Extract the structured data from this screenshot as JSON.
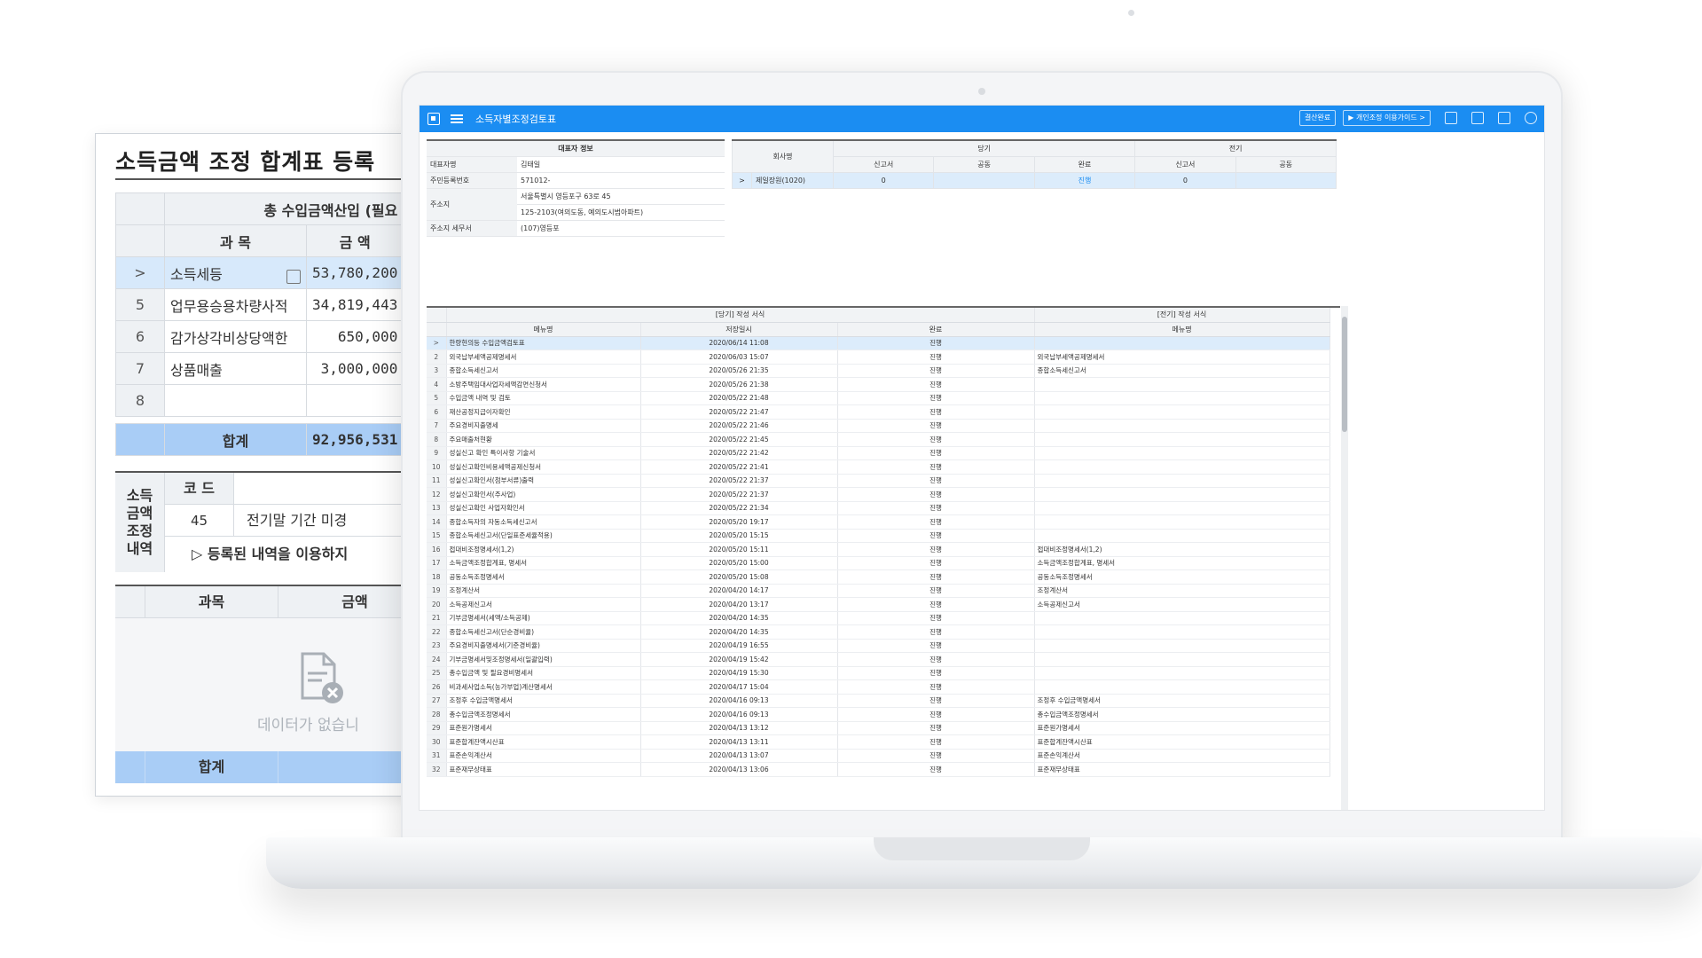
{
  "side_panel": {
    "title": "소득금액 조정 합계표 등록",
    "top_header": "총 수입금액산입 (필요",
    "col_item": "과 목",
    "col_amount": "금 액",
    "rows": [
      {
        "num": ">",
        "item": "소득세등",
        "amount": "53,780,200",
        "selected": true
      },
      {
        "num": "5",
        "item": "업무용승용차량사적",
        "amount": "34,819,443"
      },
      {
        "num": "6",
        "item": "감가상각비상당액한",
        "amount": "650,000"
      },
      {
        "num": "7",
        "item": "상품매출",
        "amount": "3,000,000"
      },
      {
        "num": "8",
        "item": "",
        "amount": ""
      }
    ],
    "total_label": "합계",
    "total_amount": "92,956,531",
    "adjust": {
      "label": "소득 금액 조정 내역",
      "code_header": "코 드",
      "code": "45",
      "desc": "전기말 기간 미경",
      "hint": "▷ 등록된 내역을 이용하지"
    },
    "grid2": {
      "col_item": "과목",
      "col_amount": "금액",
      "empty_text": "데이터가 없습니",
      "total_label": "합계"
    }
  },
  "app": {
    "title": "소득자별조정검토표",
    "btn1": "결산완료",
    "btn2": "개인조정 이용가이드 >"
  },
  "info": {
    "header": "대표자 정보",
    "rows": [
      {
        "k": "대표자명",
        "v": "김태일"
      },
      {
        "k": "주민등록번호",
        "v": "                     571012-"
      },
      {
        "k": "주소지",
        "v": "서울특별시 영등포구 63로 45"
      },
      {
        "k": "",
        "v": "125-2103(여의도동, 예의도시범아파트)"
      },
      {
        "k": "주소지 세무서",
        "v": "(107)영등포"
      }
    ]
  },
  "period": {
    "h_company": "회사명",
    "h_current": "당기",
    "h_prior": "전기",
    "sub": [
      "신고서",
      "공동",
      "완료",
      "신고서",
      "공동"
    ],
    "row": {
      "marker": ">",
      "company": "제일장원(1020)",
      "c1": "0",
      "c2": "",
      "c3": "진행",
      "c4": "0",
      "c5": ""
    }
  },
  "grid": {
    "h_current": "[당기] 작성 서식",
    "h_prior": "[전기] 작성 서식",
    "col_menu": "메뉴명",
    "col_saved": "저장일시",
    "col_done": "완료",
    "col_prior_menu": "메뉴명",
    "rows": [
      {
        "n": ">",
        "menu": "한량현의등 수입금액검토표",
        "date": "2020/06/14 11:08",
        "done": "진행",
        "prior": ""
      },
      {
        "n": "2",
        "menu": "외국납부세액공제명세서",
        "date": "2020/06/03 15:07",
        "done": "진행",
        "prior": "외국납부세액공제명세서"
      },
      {
        "n": "3",
        "menu": "종합소득세신고서",
        "date": "2020/05/26 21:35",
        "done": "진행",
        "prior": "종합소득세신고서"
      },
      {
        "n": "4",
        "menu": "소방주택임대사업자세액감면신청서",
        "date": "2020/05/26 21:38",
        "done": "진행",
        "prior": ""
      },
      {
        "n": "5",
        "menu": "수입금액 내역 및 검토",
        "date": "2020/05/22 21:48",
        "done": "진행",
        "prior": ""
      },
      {
        "n": "6",
        "menu": "재산공정지급이자확인",
        "date": "2020/05/22 21:47",
        "done": "진행",
        "prior": ""
      },
      {
        "n": "7",
        "menu": "주요경비지출명세",
        "date": "2020/05/22 21:46",
        "done": "진행",
        "prior": ""
      },
      {
        "n": "8",
        "menu": "주요매출처현황",
        "date": "2020/05/22 21:45",
        "done": "진행",
        "prior": ""
      },
      {
        "n": "9",
        "menu": "성실신고 확인 특이사항 기술서",
        "date": "2020/05/22 21:42",
        "done": "진행",
        "prior": ""
      },
      {
        "n": "10",
        "menu": "성실신고확인비용세액공제신청서",
        "date": "2020/05/22 21:41",
        "done": "진행",
        "prior": ""
      },
      {
        "n": "11",
        "menu": "성실신고확인서(첨부서류)출력",
        "date": "2020/05/22 21:37",
        "done": "진행",
        "prior": ""
      },
      {
        "n": "12",
        "menu": "성실신고확인서(주사업)",
        "date": "2020/05/22 21:37",
        "done": "진행",
        "prior": ""
      },
      {
        "n": "13",
        "menu": "성실신고확인 사업자확인서",
        "date": "2020/05/22 21:34",
        "done": "진행",
        "prior": ""
      },
      {
        "n": "14",
        "menu": "종합소득자의 자동소득세신고서",
        "date": "2020/05/20 19:17",
        "done": "진행",
        "prior": ""
      },
      {
        "n": "15",
        "menu": "종합소득세신고서(단일표준세율적용)",
        "date": "2020/05/20 15:15",
        "done": "진행",
        "prior": ""
      },
      {
        "n": "16",
        "menu": "접대비조정명세서(1,2)",
        "date": "2020/05/20 15:11",
        "done": "진행",
        "prior": "접대비조정명세서(1,2)"
      },
      {
        "n": "17",
        "menu": "소득금액조정합계표, 명세서",
        "date": "2020/05/20 15:00",
        "done": "진행",
        "prior": "소득금액조정합계표, 명세서"
      },
      {
        "n": "18",
        "menu": "공동소득조정명세서",
        "date": "2020/05/20 15:08",
        "done": "진행",
        "prior": "공동소득조정명세서"
      },
      {
        "n": "19",
        "menu": "조정계산서",
        "date": "2020/04/20 14:17",
        "done": "진행",
        "prior": "조정계산서"
      },
      {
        "n": "20",
        "menu": "소득공제신고서",
        "date": "2020/04/20 13:17",
        "done": "진행",
        "prior": "소득공제신고서"
      },
      {
        "n": "21",
        "menu": "기부금명세서(세액/소득공제)",
        "date": "2020/04/20 14:35",
        "done": "진행",
        "prior": ""
      },
      {
        "n": "22",
        "menu": "종합소득세신고서(단순경비율)",
        "date": "2020/04/20 14:35",
        "done": "진행",
        "prior": ""
      },
      {
        "n": "23",
        "menu": "주요경비지출명세서(기준경비율)",
        "date": "2020/04/19 16:55",
        "done": "진행",
        "prior": ""
      },
      {
        "n": "24",
        "menu": "기부금명세서및조정명세서(일괄입력)",
        "date": "2020/04/19 15:42",
        "done": "진행",
        "prior": ""
      },
      {
        "n": "25",
        "menu": "총수입금액 및 필요경비명세서",
        "date": "2020/04/19 15:30",
        "done": "진행",
        "prior": ""
      },
      {
        "n": "26",
        "menu": "비과세사업소득(농가부업)계산명세서",
        "date": "2020/04/17 15:04",
        "done": "진행",
        "prior": ""
      },
      {
        "n": "27",
        "menu": "조정후 수입금액명세서",
        "date": "2020/04/16 09:13",
        "done": "진행",
        "prior": "조정후 수입금액명세서"
      },
      {
        "n": "28",
        "menu": "총수입금액조정명세서",
        "date": "2020/04/16 09:13",
        "done": "진행",
        "prior": "총수입금액조정명세서"
      },
      {
        "n": "29",
        "menu": "표준원가명세서",
        "date": "2020/04/13 13:12",
        "done": "진행",
        "prior": "표준원가명세서"
      },
      {
        "n": "30",
        "menu": "표준합계잔액시산표",
        "date": "2020/04/13 13:11",
        "done": "진행",
        "prior": "표준합계잔액시산표"
      },
      {
        "n": "31",
        "menu": "표준손익계산서",
        "date": "2020/04/13 13:07",
        "done": "진행",
        "prior": "표준손익계산서"
      },
      {
        "n": "32",
        "menu": "표준재무상태표",
        "date": "2020/04/13 13:06",
        "done": "진행",
        "prior": "표준재무상태표"
      }
    ]
  }
}
